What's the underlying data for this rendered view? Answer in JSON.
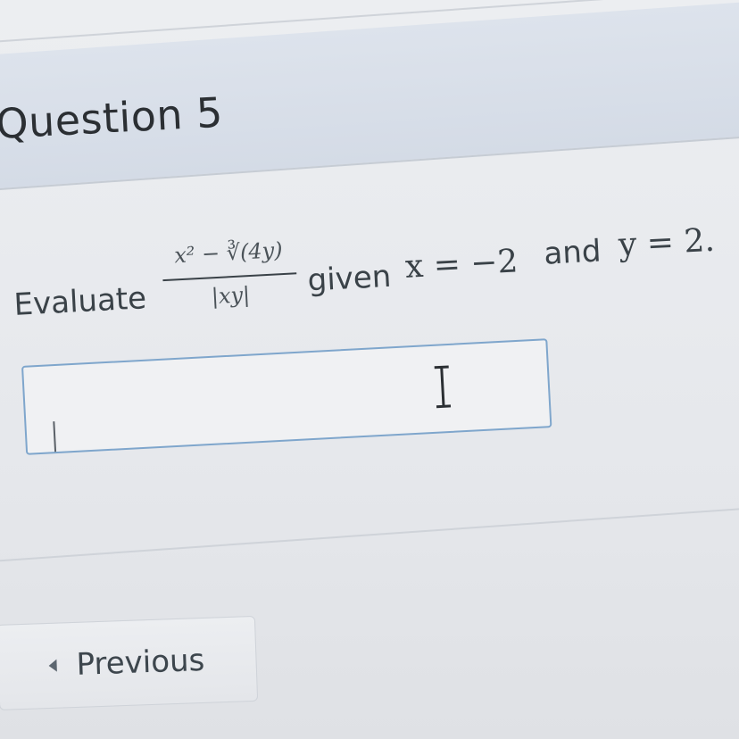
{
  "question": {
    "title": "Question 5"
  },
  "prompt": {
    "lead": "Evaluate",
    "numerator": "x² − ∛(4y)",
    "denominator": "|xy|",
    "given": "given",
    "x_condition": "x = −2",
    "and": "and",
    "y_condition": "y = 2."
  },
  "answer": {
    "value": ""
  },
  "nav": {
    "previous_label": "Previous"
  }
}
